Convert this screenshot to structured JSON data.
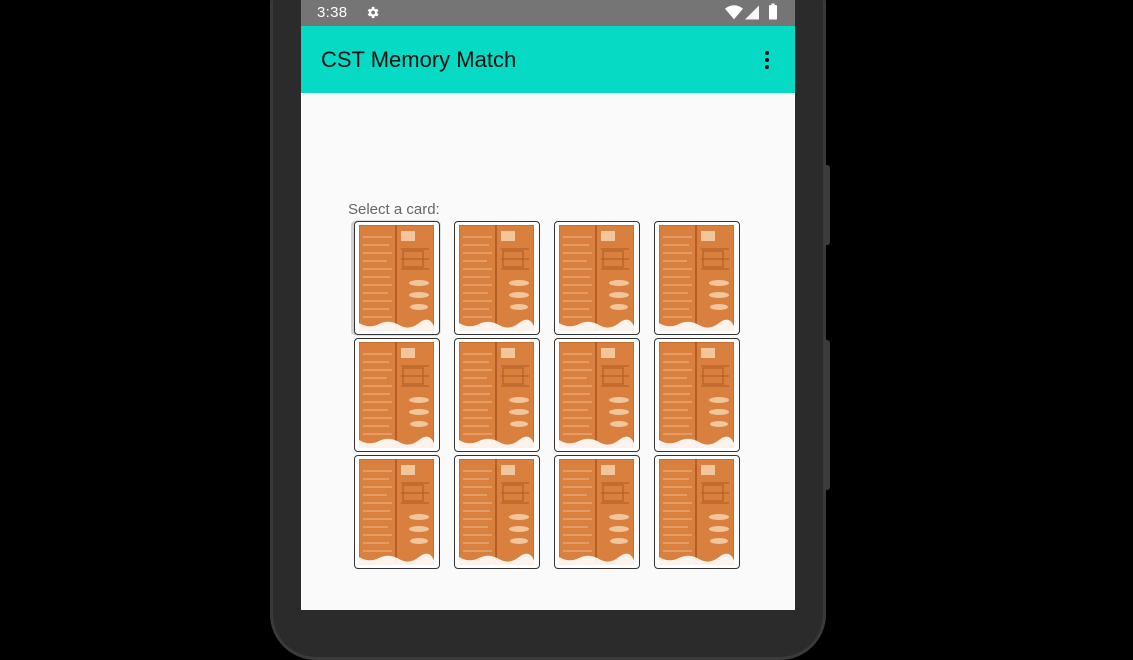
{
  "status_bar": {
    "time": "3:38",
    "icons": [
      "gear-icon",
      "wifi-icon",
      "signal-icon",
      "battery-icon"
    ]
  },
  "app_bar": {
    "title": "CST Memory Match",
    "menu_icon": "overflow-menu-icon",
    "color": "#06d9c4"
  },
  "game": {
    "prompt": "Select a card:",
    "rows": 3,
    "columns": 4,
    "cards": [
      {
        "state": "face-down",
        "selected": true
      },
      {
        "state": "face-down",
        "selected": false
      },
      {
        "state": "face-down",
        "selected": false
      },
      {
        "state": "face-down",
        "selected": false
      },
      {
        "state": "face-down",
        "selected": false
      },
      {
        "state": "face-down",
        "selected": false
      },
      {
        "state": "face-down",
        "selected": false
      },
      {
        "state": "face-down",
        "selected": false
      },
      {
        "state": "face-down",
        "selected": false
      },
      {
        "state": "face-down",
        "selected": false
      },
      {
        "state": "face-down",
        "selected": false
      },
      {
        "state": "face-down",
        "selected": false
      }
    ],
    "card_back_color": "#d9803f"
  }
}
